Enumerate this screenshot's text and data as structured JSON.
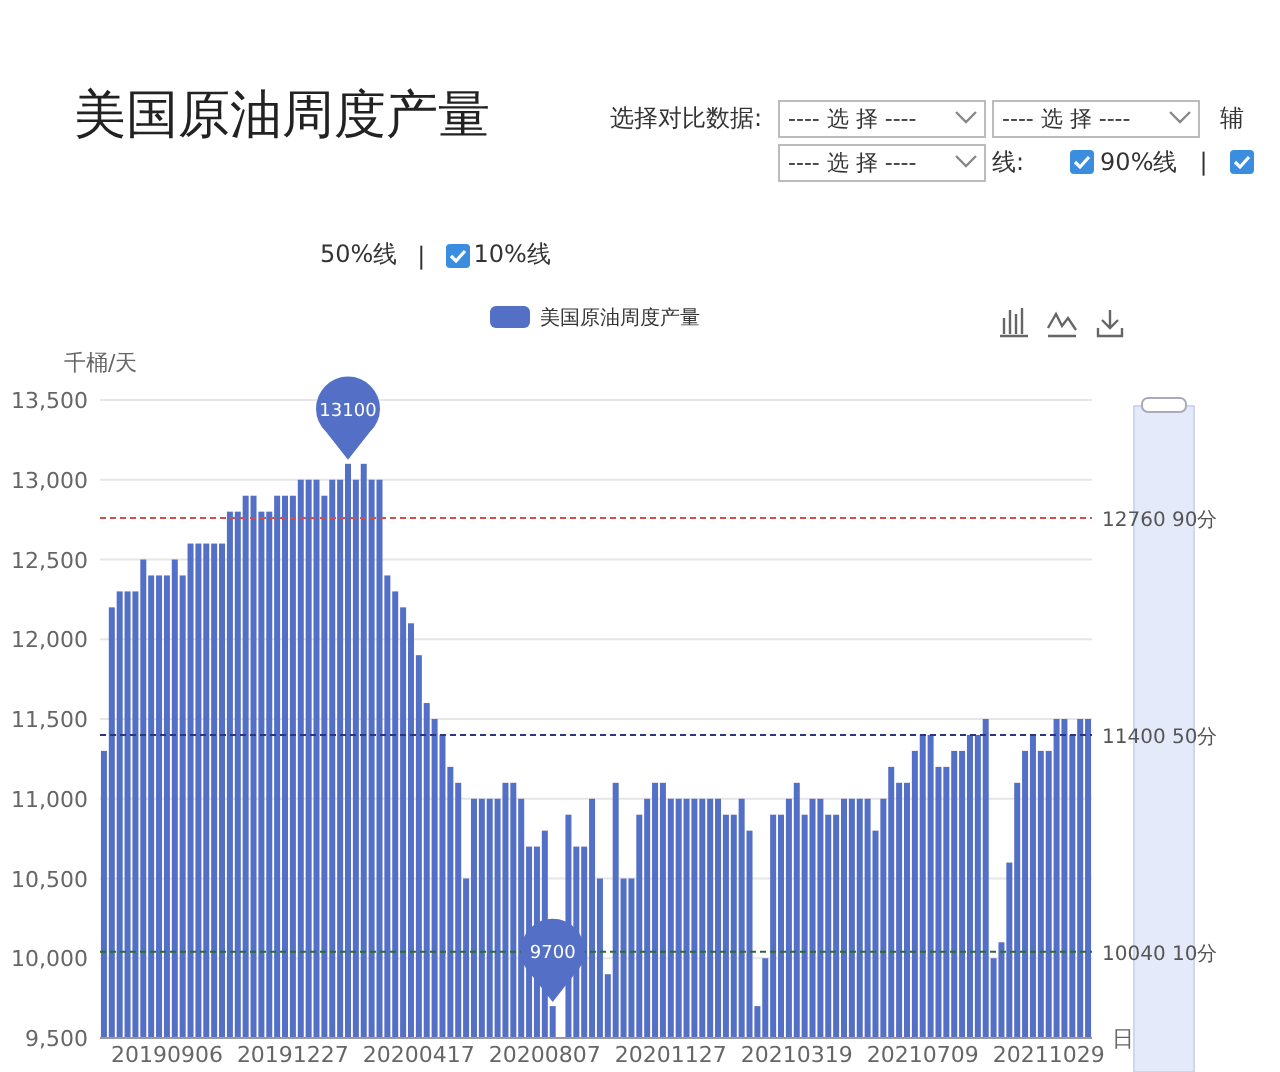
{
  "title": "美国原油周度产量",
  "compare": {
    "label": "选择对比数据:",
    "selects": [
      {
        "value": "---- 选 择 ----"
      },
      {
        "value": "---- 选 择 ----"
      },
      {
        "value": "---- 选 择 ----"
      }
    ]
  },
  "aux": {
    "label_head": "辅",
    "label_tail": "线:",
    "separator": "|",
    "options": [
      {
        "label": "90%线",
        "checked": true
      },
      {
        "checked": true
      }
    ]
  },
  "lines_row": {
    "separator": "|",
    "items": [
      {
        "label": "50%线"
      },
      {
        "label": "10%线",
        "checked": true
      }
    ]
  },
  "chart": {
    "chart_data": {
      "type": "bar",
      "ylabel": "千桶/天",
      "xlabel": "日",
      "ylim": [
        9500,
        13500
      ],
      "yticks": [
        {
          "value": 9500,
          "label": "9,500"
        },
        {
          "value": 10000,
          "label": "10,000"
        },
        {
          "value": 10500,
          "label": "10,500"
        },
        {
          "value": 11000,
          "label": "11,000"
        },
        {
          "value": 11500,
          "label": "11,500"
        },
        {
          "value": 12000,
          "label": "12,000"
        },
        {
          "value": 12500,
          "label": "12,500"
        },
        {
          "value": 13000,
          "label": "13,000"
        },
        {
          "value": 13500,
          "label": "13,500"
        }
      ],
      "grid": true,
      "categories": [
        null,
        null,
        null,
        null,
        null,
        null,
        null,
        null,
        "20190906",
        null,
        null,
        null,
        null,
        null,
        null,
        null,
        null,
        null,
        null,
        null,
        null,
        null,
        null,
        null,
        "20191227",
        null,
        null,
        null,
        null,
        null,
        null,
        null,
        null,
        null,
        null,
        null,
        null,
        null,
        null,
        null,
        "20200417",
        null,
        null,
        null,
        null,
        null,
        null,
        null,
        null,
        null,
        null,
        null,
        null,
        null,
        null,
        null,
        "20200807",
        null,
        null,
        null,
        null,
        null,
        null,
        null,
        null,
        null,
        null,
        null,
        null,
        null,
        null,
        null,
        "20201127",
        null,
        null,
        null,
        null,
        null,
        null,
        null,
        null,
        null,
        null,
        null,
        null,
        null,
        null,
        null,
        "20210319",
        null,
        null,
        null,
        null,
        null,
        null,
        null,
        null,
        null,
        null,
        null,
        null,
        null,
        null,
        null,
        "20210709",
        null,
        null,
        null,
        null,
        null,
        null,
        null,
        null,
        null,
        null,
        null,
        null,
        null,
        null,
        null,
        "20211029",
        null,
        null,
        null,
        null,
        null
      ],
      "series": [
        {
          "name": "美国原油周度产量",
          "color": "#5470c6",
          "values": [
            11300,
            12200,
            12300,
            12300,
            12300,
            12500,
            12400,
            12400,
            12400,
            12500,
            12400,
            12600,
            12600,
            12600,
            12600,
            12600,
            12800,
            12800,
            12900,
            12900,
            12800,
            12800,
            12900,
            12900,
            12900,
            13000,
            13000,
            13000,
            12900,
            13000,
            13000,
            13100,
            13000,
            13100,
            13000,
            13000,
            12400,
            12300,
            12200,
            12100,
            11900,
            11600,
            11500,
            11400,
            11200,
            11100,
            10500,
            11000,
            11000,
            11000,
            11000,
            11100,
            11100,
            11000,
            10700,
            10700,
            10800,
            9700,
            null,
            10900,
            10700,
            10700,
            11000,
            10500,
            9900,
            11100,
            10500,
            10500,
            10900,
            11000,
            11100,
            11100,
            11000,
            11000,
            11000,
            11000,
            11000,
            11000,
            11000,
            10900,
            10900,
            11000,
            10800,
            9700,
            10000,
            10900,
            10900,
            11000,
            11100,
            10900,
            11000,
            11000,
            10900,
            10900,
            11000,
            11000,
            11000,
            11000,
            10800,
            11000,
            11200,
            11100,
            11100,
            11300,
            11400,
            11400,
            11200,
            11200,
            11300,
            11300,
            11400,
            11400,
            11500,
            10000,
            10100,
            10600,
            11100,
            11300,
            11400,
            11300,
            11300,
            11500,
            11500,
            11400,
            11500,
            11500
          ]
        }
      ],
      "annotations": [
        {
          "text": "13100",
          "y": 13100
        },
        {
          "text": "9700",
          "y": 9700
        }
      ],
      "ref_lines": [
        {
          "axis": "y",
          "value": 12760,
          "label": "12760 90分",
          "color": "#d05050"
        },
        {
          "axis": "y",
          "value": 11400,
          "label": "11400 50分",
          "color": "#2c3580"
        },
        {
          "axis": "y",
          "value": 10040,
          "label": "10040 10分",
          "color": "#2e6b2e"
        }
      ]
    }
  }
}
